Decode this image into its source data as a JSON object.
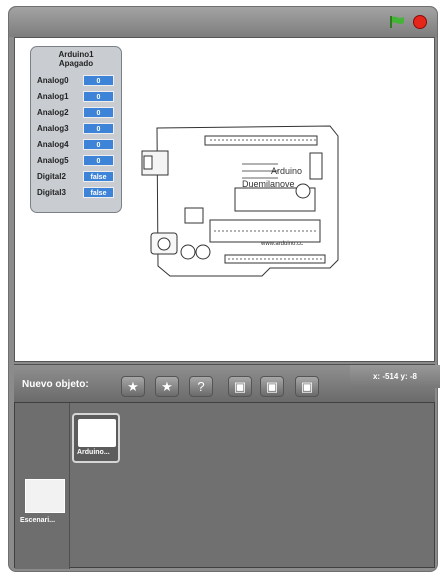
{
  "watcher": {
    "title_line1": "Arduino1",
    "title_line2": "Apagado",
    "rows": [
      {
        "label": "Analog0",
        "value": "0"
      },
      {
        "label": "Analog1",
        "value": "0"
      },
      {
        "label": "Analog2",
        "value": "0"
      },
      {
        "label": "Analog3",
        "value": "0"
      },
      {
        "label": "Analog4",
        "value": "0"
      },
      {
        "label": "Analog5",
        "value": "0"
      },
      {
        "label": "Digital2",
        "value": "false"
      },
      {
        "label": "Digital3",
        "value": "false"
      }
    ]
  },
  "board": {
    "text_top": "Arduino",
    "text_bottom": "Duemilanove",
    "chip_text": "www.arduino.cc"
  },
  "toolbar": {
    "new_sprite_label": "Nuevo objeto:",
    "coords": "x: -514   y: -8"
  },
  "sprites": {
    "sprite_label": "Arduino...",
    "stage_label": "Escenari..."
  },
  "icons": {
    "flag": "green-flag-icon",
    "stop": "stop-icon"
  }
}
